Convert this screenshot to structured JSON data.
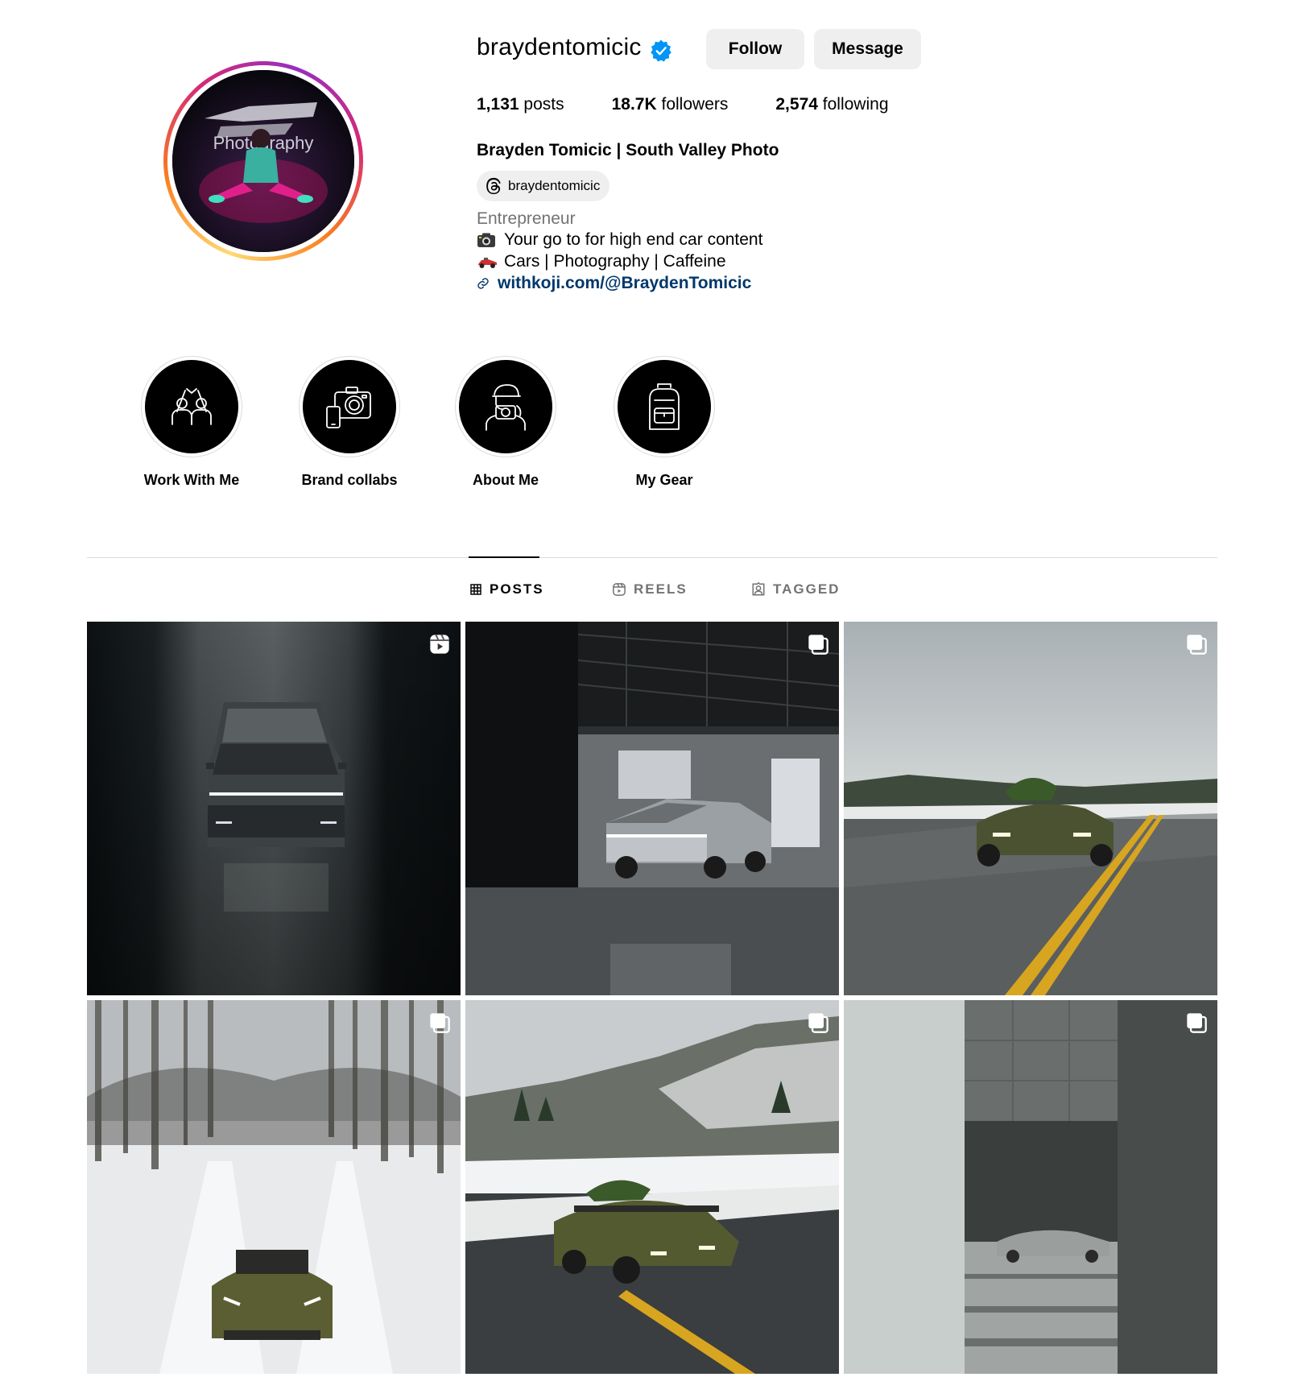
{
  "profile": {
    "username": "braydentomicic",
    "verified": true,
    "follow_label": "Follow",
    "message_label": "Message",
    "stats": {
      "posts_count": "1,131",
      "posts_label": "posts",
      "followers_count": "18.7K",
      "followers_label": "followers",
      "following_count": "2,574",
      "following_label": "following"
    },
    "full_name": "Brayden Tomicic | South Valley Photo",
    "threads_handle": "braydentomicic",
    "category": "Entrepreneur",
    "bio_lines": [
      "Your go to for high end car content",
      "Cars | Photography | Caffeine"
    ],
    "link": "withkoji.com/@BraydenTomicic",
    "avatar_text": "Photography"
  },
  "highlights": [
    {
      "label": "Work With Me",
      "icon": "high-five-icon"
    },
    {
      "label": "Brand collabs",
      "icon": "camera-phone-icon"
    },
    {
      "label": "About Me",
      "icon": "photographer-icon"
    },
    {
      "label": "My Gear",
      "icon": "backpack-icon"
    }
  ],
  "tabs": [
    {
      "label": "POSTS",
      "icon": "grid-icon",
      "active": true
    },
    {
      "label": "REELS",
      "icon": "reels-icon",
      "active": false
    },
    {
      "label": "TAGGED",
      "icon": "tagged-icon",
      "active": false
    }
  ],
  "posts": [
    {
      "type": "reel",
      "badge_icon": "reel-badge-icon"
    },
    {
      "type": "carousel",
      "badge_icon": "carousel-badge-icon"
    },
    {
      "type": "carousel",
      "badge_icon": "carousel-badge-icon"
    },
    {
      "type": "carousel",
      "badge_icon": "carousel-badge-icon"
    },
    {
      "type": "carousel",
      "badge_icon": "carousel-badge-icon"
    },
    {
      "type": "carousel",
      "badge_icon": "carousel-badge-icon"
    }
  ],
  "colors": {
    "verified_blue": "#0095f6",
    "link_blue": "#00376b",
    "button_gray": "#efefef",
    "secondary_text": "#737373"
  }
}
